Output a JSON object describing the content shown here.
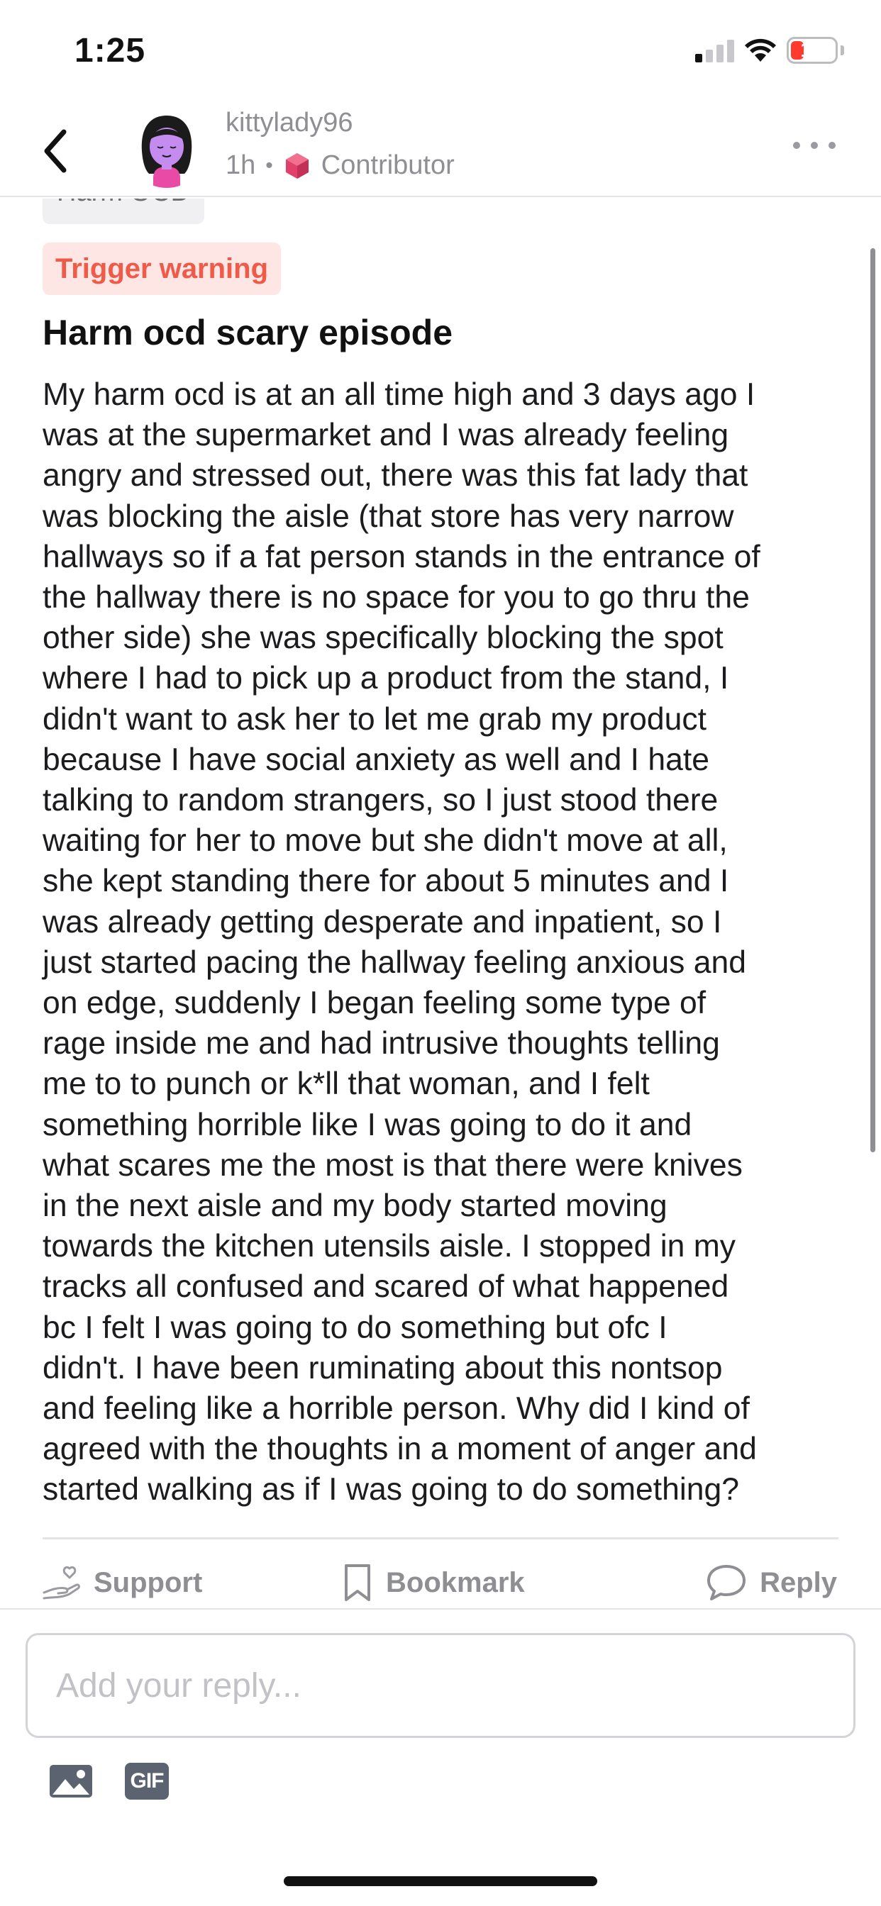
{
  "status_bar": {
    "time": "1:25",
    "battery": "19",
    "battery_color": "#ff3b30",
    "icons": [
      "cellular-signal-icon",
      "wifi-icon",
      "battery-icon"
    ]
  },
  "header": {
    "back_icon": "chevron-left-icon",
    "username": "kittylady96",
    "time_ago": "1h",
    "separator": "•",
    "role": "Contributor",
    "more_icon": "more-horizontal-icon"
  },
  "post": {
    "tag": "Harm OCD",
    "trigger_label": "Trigger warning",
    "title": "Harm ocd scary episode",
    "body_lines": [
      "My harm ocd is at an all time high and 3 days ago I",
      "was at the supermarket and I was already feeling",
      "angry and stressed out, there was this fat lady that",
      "was blocking the aisle (that store has very narrow",
      "hallways so if a fat person stands in the entrance of",
      "the hallway there is no space for you to go thru the",
      "other side) she was specifically blocking the spot",
      "where I had to pick up a product from the stand, I",
      "didn't want to ask her to let me grab my product",
      "because I have social anxiety as well and I hate",
      "talking to random strangers, so I just stood there",
      "waiting for her to move but she didn't move at all,",
      "she kept standing there for about 5 minutes and I",
      "was already getting desperate and inpatient, so I",
      "just started pacing the hallway feeling anxious and",
      "on edge, suddenly I began feeling some type of",
      "rage inside me and had intrusive thoughts telling",
      "me to to punch or k*ll that woman, and I felt",
      "something horrible like I was going to do it and",
      "what scares me the most is that there were knives",
      "in the next aisle and my body started moving",
      "towards the kitchen utensils aisle. I stopped in my",
      "tracks all confused and scared of what happened",
      "bc I felt I was going to do something but ofc I",
      "didn't. I have been ruminating about this nontsop",
      "and feeling like a horrible person. Why did I kind of",
      "agreed with the thoughts in a moment of anger and",
      "started walking as if I was going to do something?"
    ]
  },
  "actions": {
    "support_label": "Support",
    "bookmark_label": "Bookmark",
    "reply_label": "Reply"
  },
  "reply": {
    "placeholder": "Add your reply...",
    "gif_label": "GIF"
  },
  "colors": {
    "trigger_bg": "#fde6e3",
    "trigger_text": "#f05a48",
    "muted": "#8e8e93"
  }
}
